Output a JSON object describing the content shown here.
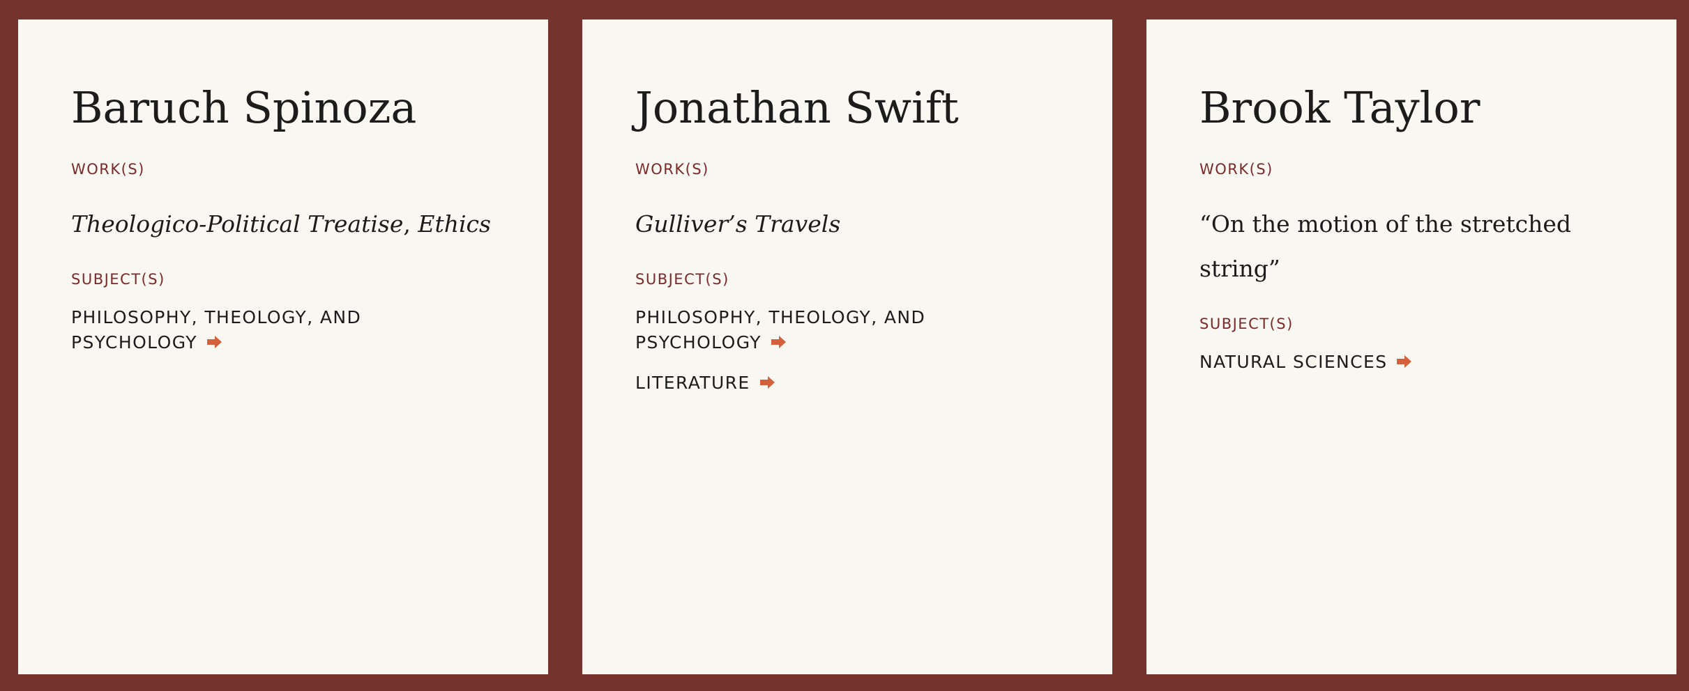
{
  "colors": {
    "background": "#74332d",
    "card": "#f9f7f2",
    "label": "#7b2a2a",
    "text": "#1c1c1c",
    "arrow": "#d4603c"
  },
  "icons": {
    "subject_link": "arrow-right-icon"
  },
  "cards": [
    {
      "name": "Baruch Spinoza",
      "works_label": "WORK(S)",
      "works": [
        {
          "text": "Theologico-Political Treatise",
          "italic": true
        },
        {
          "text": ", ",
          "italic": false
        },
        {
          "text": "Ethics",
          "italic": true
        }
      ],
      "subjects_label": "SUBJECT(S)",
      "subjects": [
        "PHILOSOPHY, THEOLOGY, AND PSYCHOLOGY"
      ]
    },
    {
      "name": "Jonathan Swift",
      "works_label": "WORK(S)",
      "works": [
        {
          "text": "Gulliver’s Travels",
          "italic": true
        }
      ],
      "subjects_label": "SUBJECT(S)",
      "subjects": [
        "PHILOSOPHY, THEOLOGY, AND PSYCHOLOGY",
        "LITERATURE"
      ]
    },
    {
      "name": "Brook Taylor",
      "works_label": "WORK(S)",
      "works": [
        {
          "text": "“On the motion of the stretched string”",
          "italic": false
        }
      ],
      "subjects_label": "SUBJECT(S)",
      "subjects": [
        "NATURAL SCIENCES"
      ]
    }
  ]
}
